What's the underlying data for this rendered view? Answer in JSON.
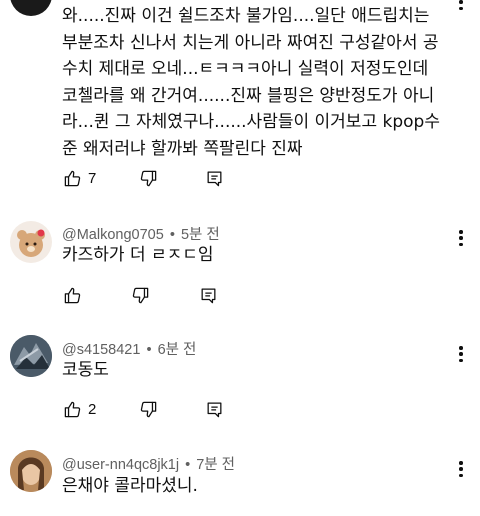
{
  "comments": [
    {
      "author": "",
      "time": "",
      "text": "와.....진짜 이건 쉴드조차 불가임....일단 애드립치는 부분조차 신나서 치는게 아니라 짜여진 구성같아서 공수치 제대로 오네...ㅌㅋㅋㅋ아니 실력이 저정도인데 코첼라를 왜 간거여......진짜 블핑은 양반정도가 아니라...퀸 그 자체였구나......사람들이 이거보고 kpop수준 왜저러냐 할까봐 쪽팔린다 진짜",
      "likes": "7",
      "icons": [
        "thumb-up-icon",
        "thumb-down-icon",
        "reply-icon"
      ]
    },
    {
      "author": "@Malkong0705",
      "separator": "•",
      "time": "5분 전",
      "text": "카즈하가 더 ㄹㅈㄷ임",
      "likes": "",
      "avatar_color": "#f3ebe4"
    },
    {
      "author": "@s4158421",
      "separator": "•",
      "time": "6분 전",
      "text": "코동도",
      "likes": "2",
      "avatar_color": "#3b4a58"
    },
    {
      "author": "@user-nn4qc8jk1j",
      "separator": "•",
      "time": "7분 전",
      "text": "은채야 콜라마셨니.",
      "likes": "",
      "avatar_color": "#a8794f"
    }
  ],
  "colors": {
    "text": "#0f0f0f",
    "meta": "#606060",
    "background": "#ffffff"
  }
}
